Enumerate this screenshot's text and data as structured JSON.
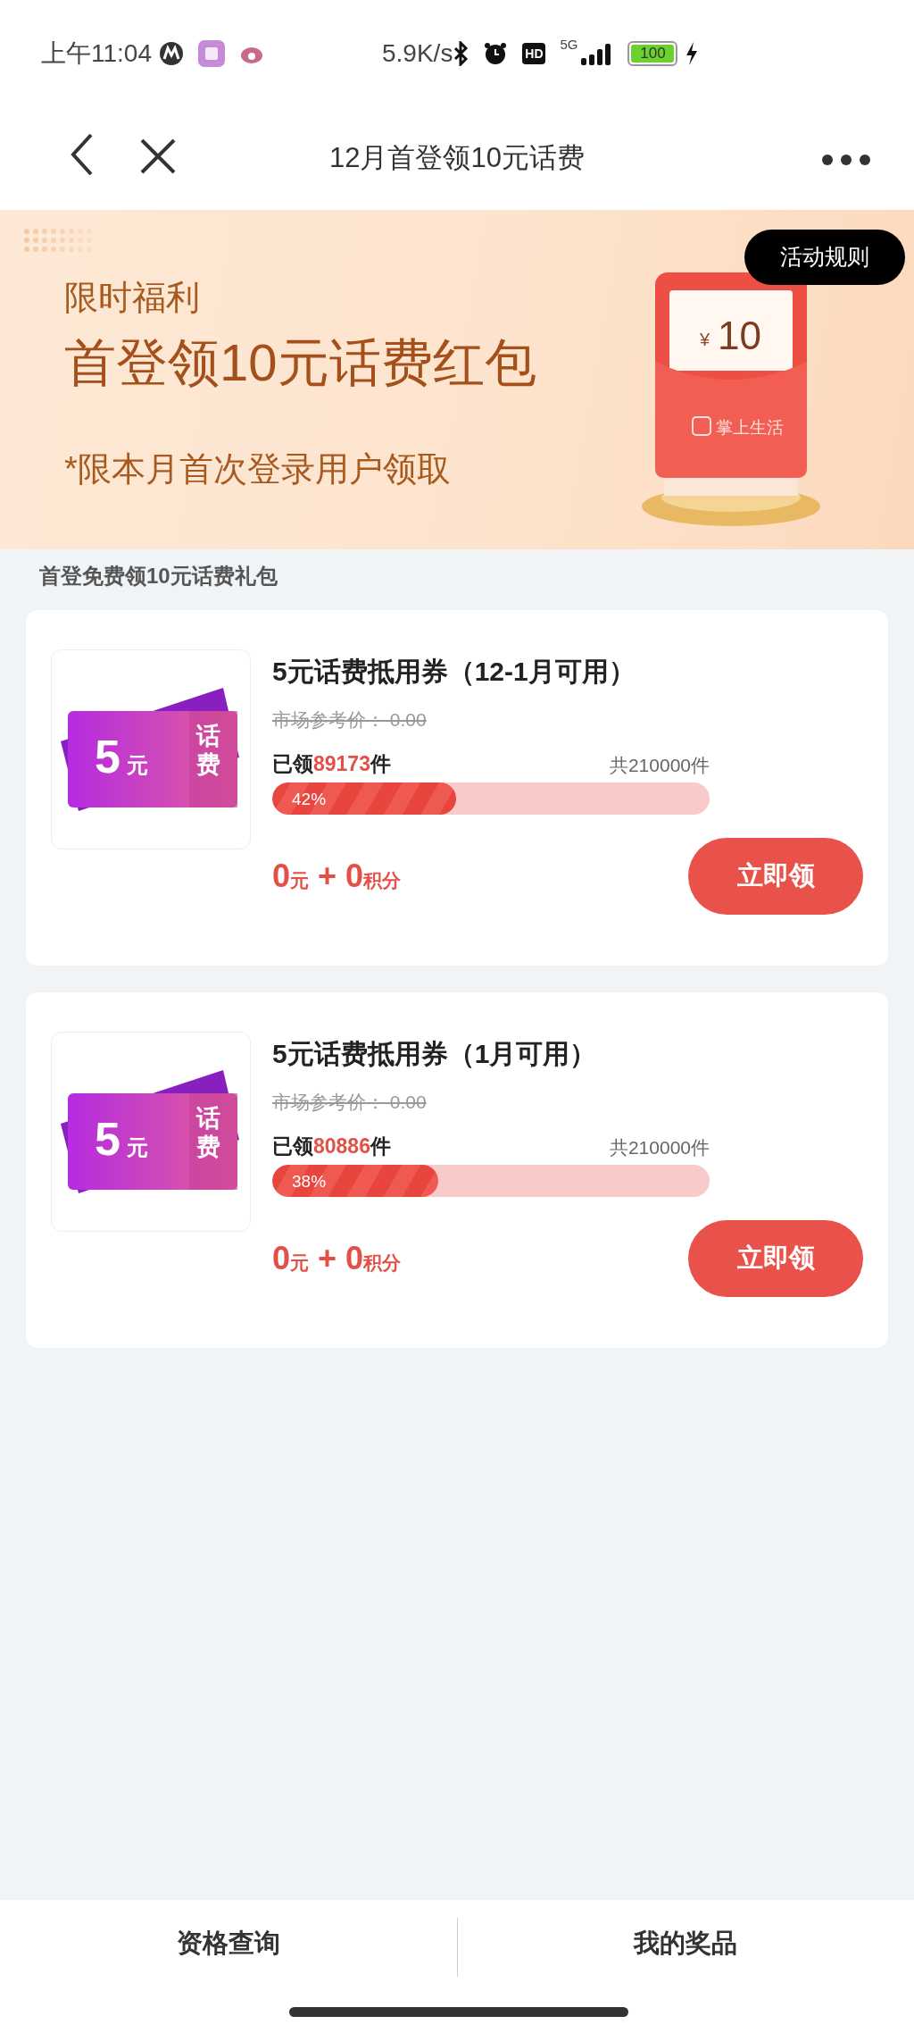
{
  "status_bar": {
    "time": "上午11:04",
    "network_speed": "5.9K/s",
    "hd_badge": "HD",
    "network_type": "5G",
    "battery": "100"
  },
  "nav": {
    "title": "12月首登领10元话费"
  },
  "banner": {
    "subtitle": "限时福利",
    "headline": "首登领10元话费红包",
    "note": "*限本月首次登录用户领取",
    "rules_button": "活动规则",
    "envelope_currency": "¥",
    "envelope_amount": "10",
    "envelope_brand": "掌上生活"
  },
  "section_title": "首登免费领10元话费礼包",
  "coupons": [
    {
      "thumb_amount": "5",
      "thumb_unit": "元",
      "thumb_label": "话费",
      "title": "5元话费抵用券（12-1月可用）",
      "market_price": "市场参考价： 0.00",
      "claimed_prefix": "已领",
      "claimed_count": "89173",
      "claimed_suffix": "件",
      "total": "共210000件",
      "level": 0.42,
      "percent": "42%",
      "price": "0",
      "price_unit": "元",
      "plus": "+",
      "points": "0",
      "points_unit": "积分",
      "button": "立即领"
    },
    {
      "thumb_amount": "5",
      "thumb_unit": "元",
      "thumb_label": "话费",
      "title": "5元话费抵用券（1月可用）",
      "market_price": "市场参考价： 0.00",
      "claimed_prefix": "已领",
      "claimed_count": "80886",
      "claimed_suffix": "件",
      "total": "共210000件",
      "level": 0.38,
      "percent": "38%",
      "price": "0",
      "price_unit": "元",
      "plus": "+",
      "points": "0",
      "points_unit": "积分",
      "button": "立即领"
    }
  ],
  "bottom_tabs": [
    {
      "label": "资格查询"
    },
    {
      "label": "我的奖品"
    }
  ]
}
